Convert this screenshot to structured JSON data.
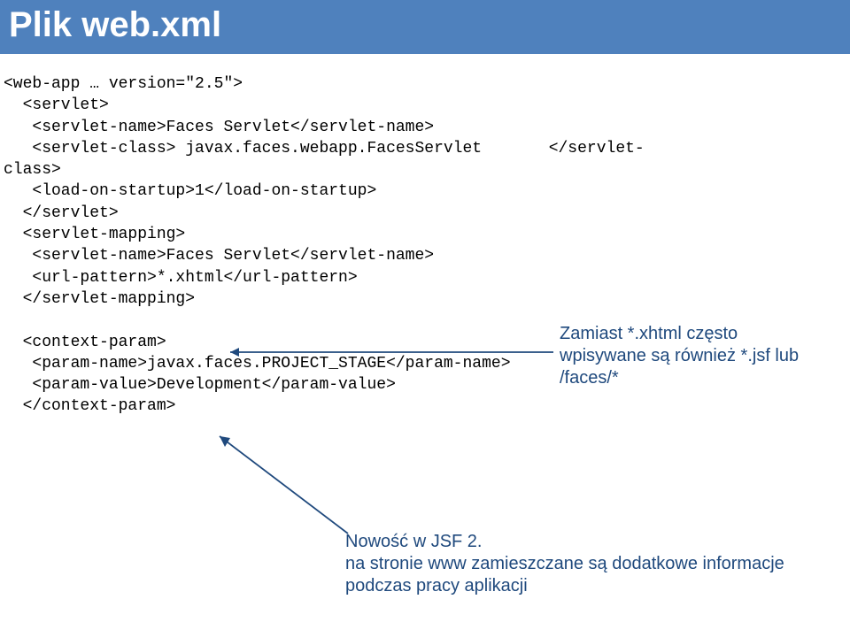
{
  "title": "Plik web.xml",
  "code": {
    "l1": "<web-app … version=\"2.5\">",
    "l2": "  <servlet>",
    "l3": "   <servlet-name>Faces Servlet</servlet-name>",
    "l4": "   <servlet-class> javax.faces.webapp.FacesServlet       </servlet-",
    "l5": "class>",
    "l6": "   <load-on-startup>1</load-on-startup>",
    "l7": "  </servlet>",
    "l8": "  <servlet-mapping>",
    "l9": "   <servlet-name>Faces Servlet</servlet-name>",
    "l10": "   <url-pattern>*.xhtml</url-pattern>",
    "l11": "  </servlet-mapping>",
    "l12": "",
    "l13": "  <context-param>",
    "l14": "   <param-name>javax.faces.PROJECT_STAGE</param-name>",
    "l15": "   <param-value>Development</param-value>",
    "l16": "  </context-param>"
  },
  "annotations": {
    "a1": "Zamiast *.xhtml często wpisywane są również *.jsf lub /faces/*",
    "a2_line1": "Nowość w JSF 2.",
    "a2_line2": "na stronie www zamieszczane są dodatkowe informacje podczas pracy aplikacji"
  }
}
